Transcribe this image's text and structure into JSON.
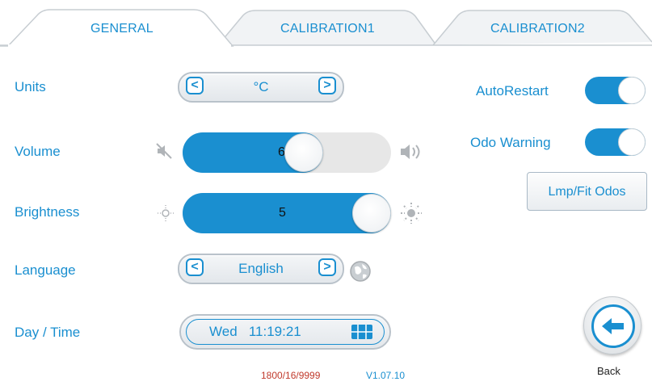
{
  "tabs": [
    {
      "label": "GENERAL",
      "active": true
    },
    {
      "label": "CALIBRATION1",
      "active": false
    },
    {
      "label": "CALIBRATION2",
      "active": false
    }
  ],
  "units": {
    "label": "Units",
    "value": "°C",
    "prev": "<",
    "next": ">"
  },
  "volume": {
    "label": "Volume",
    "value": "6",
    "level": 0.6
  },
  "brightness": {
    "label": "Brightness",
    "value": "5",
    "level": 1.0
  },
  "language": {
    "label": "Language",
    "value": "English",
    "prev": "<",
    "next": ">"
  },
  "datetime": {
    "label": "Day  /  Time",
    "value": "Wed   11:19:21"
  },
  "auto_restart": {
    "label": "AutoRestart",
    "on": true
  },
  "odo_warning": {
    "label": "Odo Warning",
    "on": true
  },
  "lmp_button": {
    "label": "Lmp/Fit Odos"
  },
  "back": {
    "label": "Back"
  },
  "footer": {
    "serial": "1800/16/9999",
    "version": "V1.07.10"
  },
  "colors": {
    "accent": "#1a8fd0",
    "serial": "#c0392b",
    "version": "#1a8fd0"
  }
}
